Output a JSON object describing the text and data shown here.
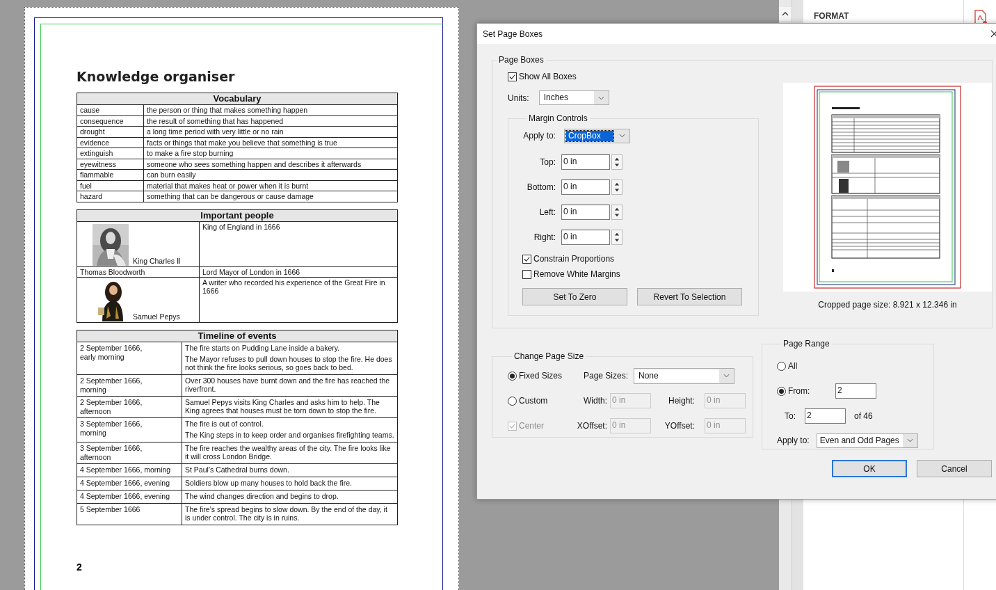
{
  "document": {
    "title": "Knowledge organiser",
    "page_number": "2",
    "vocabulary": {
      "heading": "Vocabulary",
      "rows": [
        {
          "term": "cause",
          "definition": "the person or thing that makes something happen"
        },
        {
          "term": "consequence",
          "definition": "the result of something that has happened"
        },
        {
          "term": "drought",
          "definition": "a long time period with very little or no rain"
        },
        {
          "term": "evidence",
          "definition": "facts or things that make you believe that something is true"
        },
        {
          "term": "extinguish",
          "definition": "to make a fire stop burning"
        },
        {
          "term": "eyewitness",
          "definition": "someone who sees something happen and describes it afterwards"
        },
        {
          "term": "flammable",
          "definition": "can burn easily"
        },
        {
          "term": "fuel",
          "definition": "material that makes heat or power when it is burnt"
        },
        {
          "term": "hazard",
          "definition": "something that can be dangerous or cause damage"
        }
      ]
    },
    "people": {
      "heading": "Important people",
      "rows": [
        {
          "name": "King Charles Ⅱ",
          "description": "King of England in 1666",
          "kind": "picture"
        },
        {
          "name": "Thomas Bloodworth",
          "description": "Lord Mayor of London in 1666",
          "kind": "text"
        },
        {
          "name": "Samuel Pepys",
          "description": "A writer who recorded his experience of the Great Fire in 1666",
          "kind": "picture"
        }
      ]
    },
    "timeline": {
      "heading": "Timeline of events",
      "rows": [
        {
          "date": [
            "2 September 1666,",
            "early morning"
          ],
          "events": [
            "The fire starts on Pudding Lane inside a bakery.",
            "The Mayor refuses to pull down houses to stop the fire. He does not think the fire looks serious, so goes back to bed."
          ]
        },
        {
          "date": [
            "2 September 1666,",
            "morning"
          ],
          "events": [
            "Over 300 houses have burnt down and the fire has reached the riverfront."
          ]
        },
        {
          "date": [
            "2 September 1666,",
            "afternoon"
          ],
          "events": [
            "Samuel Pepys visits King Charles and asks him to help. The King agrees that houses must be torn down to stop the fire."
          ]
        },
        {
          "date": [
            "3 September 1666,",
            "morning"
          ],
          "events": [
            "The fire is out of control.",
            "The King steps in to keep order and organises firefighting teams."
          ]
        },
        {
          "date": [
            "3 September 1666,",
            "afternoon"
          ],
          "events": [
            "The fire reaches the wealthy areas of the city. The fire looks like it will cross London Bridge."
          ]
        },
        {
          "date": [
            "4 September 1666, morning"
          ],
          "events": [
            "St Paul’s Cathedral burns down."
          ]
        },
        {
          "date": [
            "4 September 1666, evening"
          ],
          "events": [
            "Soldiers blow up many houses to hold back the fire."
          ]
        },
        {
          "date": [
            "4 September 1666, evening"
          ],
          "events": [
            "The wind changes direction and begins to drop."
          ]
        },
        {
          "date": [
            "5 September 1666"
          ],
          "events": [
            "The fire’s spread begins to slow down. By the end of the day, it is under control. The city is in ruins."
          ]
        }
      ]
    }
  },
  "side_panel": {
    "heading": "FORMAT"
  },
  "dialog": {
    "title": "Set Page Boxes",
    "page_boxes": {
      "label": "Page Boxes",
      "show_all": {
        "label": "Show All Boxes",
        "checked": true
      },
      "units": {
        "label": "Units:",
        "value": "Inches"
      },
      "margin_controls": {
        "label": "Margin Controls",
        "apply_to": {
          "label": "Apply to:",
          "value": "CropBox"
        },
        "margins": [
          {
            "label": "Top:",
            "value": "0 in"
          },
          {
            "label": "Bottom:",
            "value": "0 in"
          },
          {
            "label": "Left:",
            "value": "0 in"
          },
          {
            "label": "Right:",
            "value": "0 in"
          }
        ],
        "options": [
          {
            "label": "Constrain Proportions",
            "checked": true
          },
          {
            "label": "Remove White Margins",
            "checked": false
          }
        ],
        "buttons": [
          "Set To Zero",
          "Revert To Selection"
        ]
      },
      "cropped_size": "Cropped page size: 8.921 x 12.346 in"
    },
    "change_page_size": {
      "label": "Change Page Size",
      "modes": [
        {
          "label": "Fixed Sizes",
          "selected": true
        },
        {
          "label": "Custom",
          "selected": false
        }
      ],
      "page_sizes": {
        "label": "Page Sizes:",
        "value": "None"
      },
      "width": {
        "label": "Width:",
        "value": "0 in",
        "disabled": true
      },
      "height": {
        "label": "Height:",
        "value": "0 in",
        "disabled": true
      },
      "center": {
        "label": "Center",
        "checked": true,
        "disabled": true
      },
      "xoffset": {
        "label": "XOffset:",
        "value": "0 in",
        "disabled": true
      },
      "yoffset": {
        "label": "YOffset:",
        "value": "0 in",
        "disabled": true
      }
    },
    "page_range": {
      "label": "Page Range",
      "options": [
        {
          "label": "All",
          "selected": false
        },
        {
          "label": "From:",
          "selected": true
        }
      ],
      "from": "2",
      "to_label": "To:",
      "to": "2",
      "of": "of 46",
      "apply_to": {
        "label": "Apply to:",
        "value": "Even and Odd Pages"
      }
    },
    "buttons": [
      {
        "label": "OK",
        "default": true
      },
      {
        "label": "Cancel",
        "default": false
      }
    ]
  }
}
